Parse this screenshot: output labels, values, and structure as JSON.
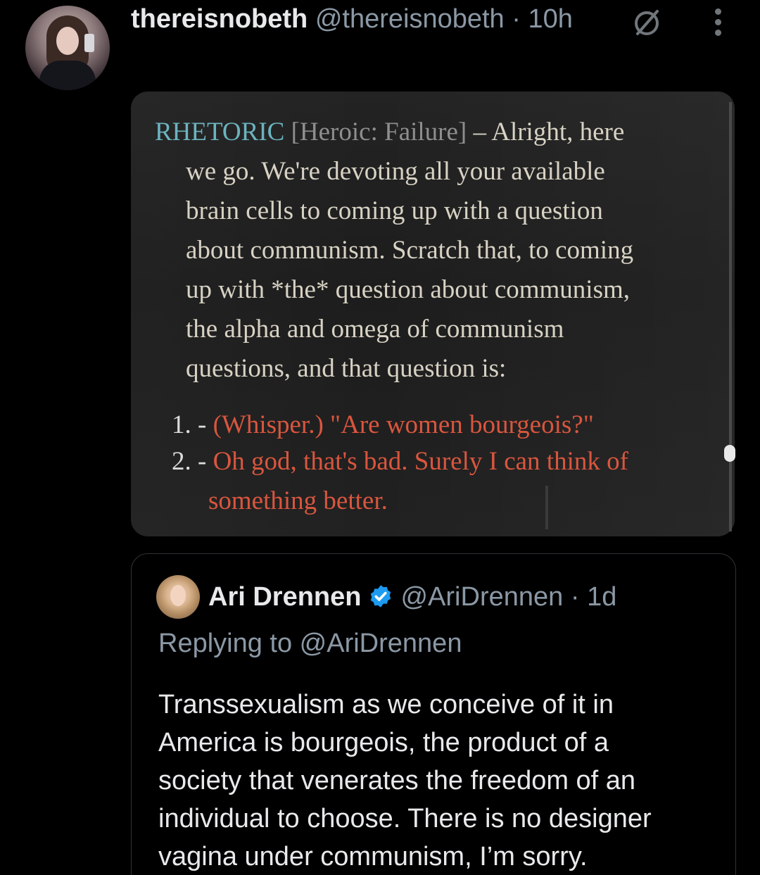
{
  "tweet": {
    "display_name": "thereisnobeth",
    "handle": "@thereisnobeth",
    "separator": "·",
    "time": "10h",
    "icons": {
      "avatar": "user-avatar",
      "blocked": "circle-slash-icon",
      "more": "more-vertical-icon"
    }
  },
  "game_screenshot": {
    "skill": "RHETORIC",
    "check": "[Heroic: Failure]",
    "dash": "–",
    "lines": [
      "Alright, here",
      "we go. We're devoting all your available",
      "brain cells to coming up with a question",
      "about communism. Scratch that, to coming",
      "up with *the* question about communism,",
      "the alpha and omega of communism",
      "questions, and that question is:"
    ],
    "options": [
      {
        "number": "1. -",
        "text": "(Whisper.) \"Are women bourgeois?\""
      },
      {
        "number": "2. -",
        "text": "Oh god, that's bad. Surely I can think of",
        "continuation": "something better."
      }
    ],
    "colors": {
      "skill": "#6cb4bf",
      "check": "#8e8e8e",
      "body": "#d8d2c4",
      "option": "#d9563e"
    }
  },
  "quoted_tweet": {
    "display_name": "Ari Drennen",
    "verified": "verified-badge-icon",
    "handle": "@AriDrennen",
    "separator": "·",
    "time": "1d",
    "replying_to": "Replying to @AriDrennen",
    "body_lines": [
      "Transsexualism as we conceive of it in",
      "America is bourgeois, the product of a",
      "society that venerates the freedom of an",
      "individual to choose. There is no designer",
      "vagina under communism, I’m sorry."
    ]
  }
}
